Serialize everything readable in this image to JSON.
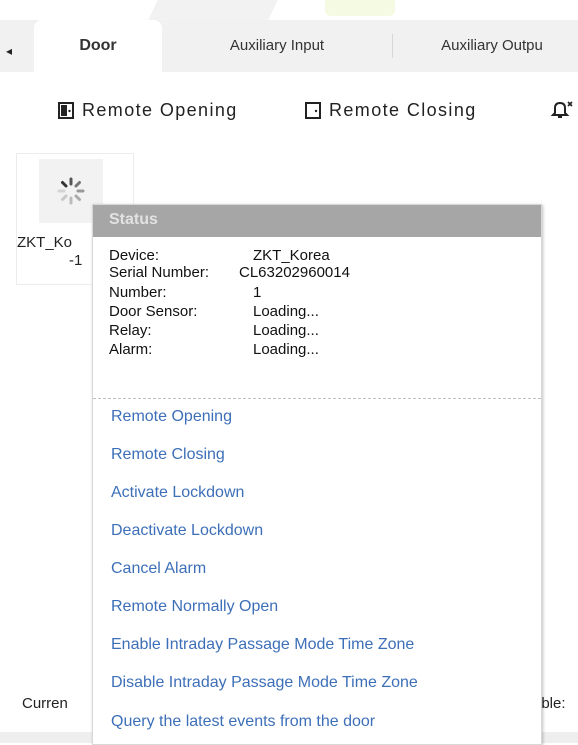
{
  "tabs": [
    {
      "label": "Door",
      "active": true
    },
    {
      "label": "Auxiliary Input",
      "active": false
    },
    {
      "label": "Auxiliary Outpu",
      "active": false
    }
  ],
  "toolbar": {
    "remote_opening": "Remote Opening",
    "remote_closing": "Remote Closing"
  },
  "door": {
    "name_line1": "ZKT_Ko",
    "name_line2": "-1",
    "icon": "loading-spinner-icon"
  },
  "status_popup": {
    "title": "Status",
    "rows": [
      {
        "label": "Device:",
        "value": "ZKT_Korea"
      },
      {
        "label": "Serial Number:",
        "value": "CL63202960014"
      },
      {
        "label": "Number:",
        "value": "1"
      },
      {
        "label": "Door Sensor:",
        "value": "Loading..."
      },
      {
        "label": "Relay:",
        "value": "Loading..."
      },
      {
        "label": "Alarm:",
        "value": "Loading..."
      }
    ],
    "actions": [
      "Remote Opening",
      "Remote Closing",
      "Activate Lockdown",
      "Deactivate Lockdown",
      "Cancel Alarm",
      "Remote Normally Open",
      "Enable Intraday Passage Mode Time Zone",
      "Disable Intraday Passage Mode Time Zone",
      "Query the latest events from the door"
    ]
  },
  "footer": {
    "left_text": "Curren",
    "right_text": "ible:"
  },
  "colors": {
    "link": "#3d6fb8",
    "popup_header": "#a6a6a6",
    "tabbar_bg": "#f1f1f1"
  }
}
